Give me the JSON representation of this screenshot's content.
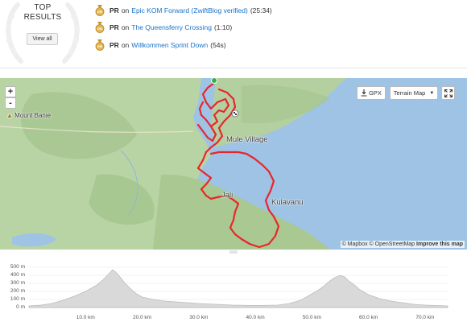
{
  "top_results": {
    "title_line1": "TOP",
    "title_line2": "RESULTS",
    "view_all_label": "View all",
    "items": [
      {
        "badge": "PR",
        "on": "on",
        "segment": "Epic KOM Forward (ZwiftBlog verified)",
        "time": "(25:34)",
        "medal_icon": "pr-medal-icon"
      },
      {
        "badge": "PR",
        "on": "on",
        "segment": "The Queensferry Crossing",
        "time": "(1:10)",
        "medal_icon": "pr-medal-icon"
      },
      {
        "badge": "PR",
        "on": "on",
        "segment": "Willkommen Sprint Down",
        "time": "(54s)",
        "medal_icon": "pr-medal-icon"
      }
    ],
    "colors": {
      "link": "#1a73c9",
      "medal": "#d8a63a"
    }
  },
  "map": {
    "controls": {
      "zoom_in": "+",
      "zoom_out": "-",
      "gpx_label": "GPX",
      "map_type_label": "Terrain Map"
    },
    "places": [
      "Mount Banie",
      "Mule Village",
      "Jali",
      "Kulavanu"
    ],
    "attribution": {
      "mapbox": "© Mapbox",
      "osm": "© OpenStreetMap",
      "improve": "Improve this map"
    },
    "colors": {
      "route": "#e8262b",
      "water": "#9ec3e4",
      "land": "#b9d4a4",
      "start_marker": "#31b240"
    },
    "icons": [
      "download-icon",
      "caret-down-icon",
      "fullscreen-icon",
      "checkered-flag-icon",
      "start-marker-icon"
    ]
  },
  "elevation": {
    "y_ticks": [
      "500 m",
      "400 m",
      "300 m",
      "200 m",
      "100 m",
      "0 m"
    ],
    "x_ticks": [
      "10.0 km",
      "20.0 km",
      "30.0 km",
      "40.0 km",
      "50.0 km",
      "60.0 km",
      "70.0 km"
    ],
    "y_range_m": [
      0,
      500
    ],
    "x_range_km": [
      0,
      74
    ],
    "profile_km_m": [
      [
        0,
        20
      ],
      [
        2,
        28
      ],
      [
        4,
        50
      ],
      [
        6,
        90
      ],
      [
        8,
        140
      ],
      [
        10,
        200
      ],
      [
        11,
        240
      ],
      [
        12,
        280
      ],
      [
        13,
        340
      ],
      [
        14,
        410
      ],
      [
        14.8,
        470
      ],
      [
        15.5,
        430
      ],
      [
        16.2,
        370
      ],
      [
        17,
        300
      ],
      [
        18,
        230
      ],
      [
        19,
        170
      ],
      [
        20,
        130
      ],
      [
        22,
        100
      ],
      [
        24,
        80
      ],
      [
        26,
        70
      ],
      [
        28,
        60
      ],
      [
        30,
        50
      ],
      [
        33,
        40
      ],
      [
        36,
        30
      ],
      [
        40,
        25
      ],
      [
        44,
        30
      ],
      [
        46,
        50
      ],
      [
        48,
        90
      ],
      [
        49.5,
        150
      ],
      [
        51,
        210
      ],
      [
        52,
        260
      ],
      [
        53,
        320
      ],
      [
        54,
        370
      ],
      [
        55,
        400
      ],
      [
        55.8,
        380
      ],
      [
        56.5,
        330
      ],
      [
        57.5,
        280
      ],
      [
        58.5,
        220
      ],
      [
        60,
        160
      ],
      [
        62,
        110
      ],
      [
        64,
        80
      ],
      [
        66,
        60
      ],
      [
        68,
        40
      ],
      [
        70,
        30
      ],
      [
        72,
        25
      ],
      [
        74,
        20
      ]
    ],
    "colors": {
      "fill": "#d9d9d9",
      "stroke": "#bdbdbd"
    }
  }
}
